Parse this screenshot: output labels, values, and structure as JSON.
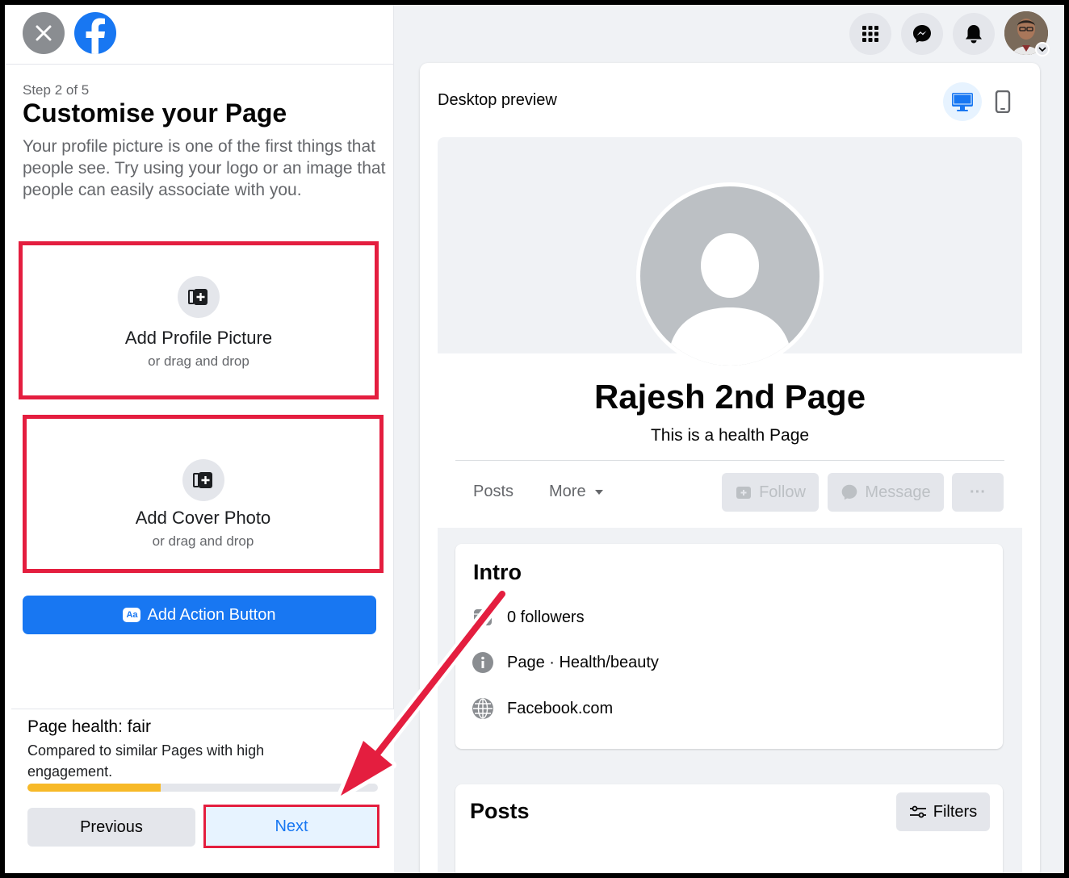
{
  "left_panel": {
    "step": "Step 2 of 5",
    "title": "Customise your Page",
    "description": "Your profile picture is one of the first things that people see. Try using your logo or an image that people can easily associate with you.",
    "profile_upload": {
      "label": "Add Profile Picture",
      "sub": "or drag and drop"
    },
    "cover_upload": {
      "label": "Add Cover Photo",
      "sub": "or drag and drop"
    },
    "action_button": {
      "badge": "Aa",
      "label": "Add Action Button"
    },
    "health": {
      "title": "Page health: fair",
      "description": "Compared to similar Pages with high engagement.",
      "progress": 0.38
    },
    "previous_label": "Previous",
    "next_label": "Next"
  },
  "header_icons": [
    "menu-grid-icon",
    "messenger-icon",
    "bell-icon",
    "avatar"
  ],
  "preview": {
    "label": "Desktop preview",
    "page_name": "Rajesh 2nd Page",
    "page_category": "This is a health Page",
    "tabs": [
      "Posts",
      "More"
    ],
    "follow_label": "Follow",
    "message_label": "Message",
    "more_dots": "···",
    "intro": {
      "title": "Intro",
      "followers": "0 followers",
      "category": "Page · Health/beauty",
      "website": "Facebook.com"
    },
    "posts_title": "Posts",
    "filters_label": "Filters"
  },
  "colors": {
    "brand_blue": "#1877f2",
    "highlight_red": "#e41e3f",
    "progress_orange": "#f7b928",
    "page_bg": "#f0f2f5"
  }
}
